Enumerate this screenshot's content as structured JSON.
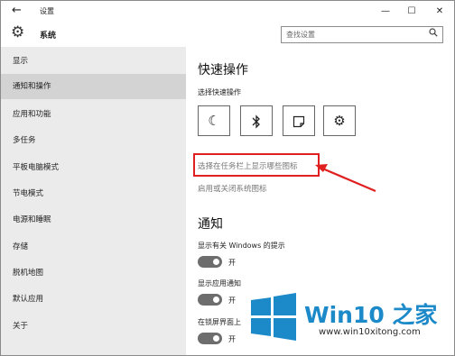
{
  "window": {
    "title": "设置"
  },
  "titlebar": {
    "back": "←",
    "minimize": "—",
    "maximize": "☐",
    "close": "✕"
  },
  "header": {
    "title": "系统",
    "search_placeholder": "查找设置"
  },
  "sidebar": {
    "items": [
      {
        "label": "显示"
      },
      {
        "label": "通知和操作"
      },
      {
        "label": "应用和功能"
      },
      {
        "label": "多任务"
      },
      {
        "label": "平板电脑模式"
      },
      {
        "label": "节电模式"
      },
      {
        "label": "电源和睡眠"
      },
      {
        "label": "存储"
      },
      {
        "label": "脱机地图"
      },
      {
        "label": "默认应用"
      },
      {
        "label": "关于"
      }
    ],
    "active": "通知和操作"
  },
  "main": {
    "quick_actions_title": "快速操作",
    "quick_actions_sub": "选择快速操作",
    "quick_action_icons": [
      "moon-icon",
      "bluetooth-icon",
      "note-icon",
      "gear-icon"
    ],
    "link_taskbar_icons": "选择在任务栏上显示哪些图标",
    "link_system_icons": "启用或关闭系统图标",
    "notifications_title": "通知",
    "setting_1": "显示有关 Windows 的提示",
    "setting_1_state": "开",
    "setting_2": "显示应用通知",
    "setting_2_state": "开",
    "setting_3": "在锁屏界面上",
    "setting_3_state": "开"
  },
  "watermark": {
    "brand": "Win10 之家",
    "site": "www.win10xitong.com"
  },
  "colors": {
    "highlight": "#e02020",
    "brand_blue": "#1c89c9",
    "toggle_on": "#6d6d6d"
  }
}
